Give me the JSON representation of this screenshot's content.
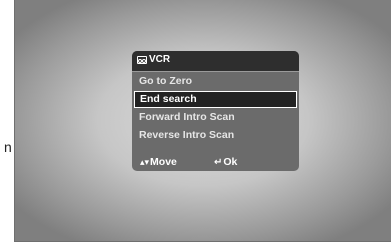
{
  "edge_text": "n",
  "menu": {
    "title": "VCR",
    "items": [
      {
        "label": "Go to Zero"
      },
      {
        "label": "End search"
      },
      {
        "label": "Forward Intro Scan"
      },
      {
        "label": "Reverse Intro Scan"
      }
    ],
    "selected_index": 1,
    "footer": {
      "move_label": "Move",
      "ok_label": "Ok",
      "move_icon": "up-down-arrow-icon",
      "ok_icon": "enter-icon"
    }
  }
}
